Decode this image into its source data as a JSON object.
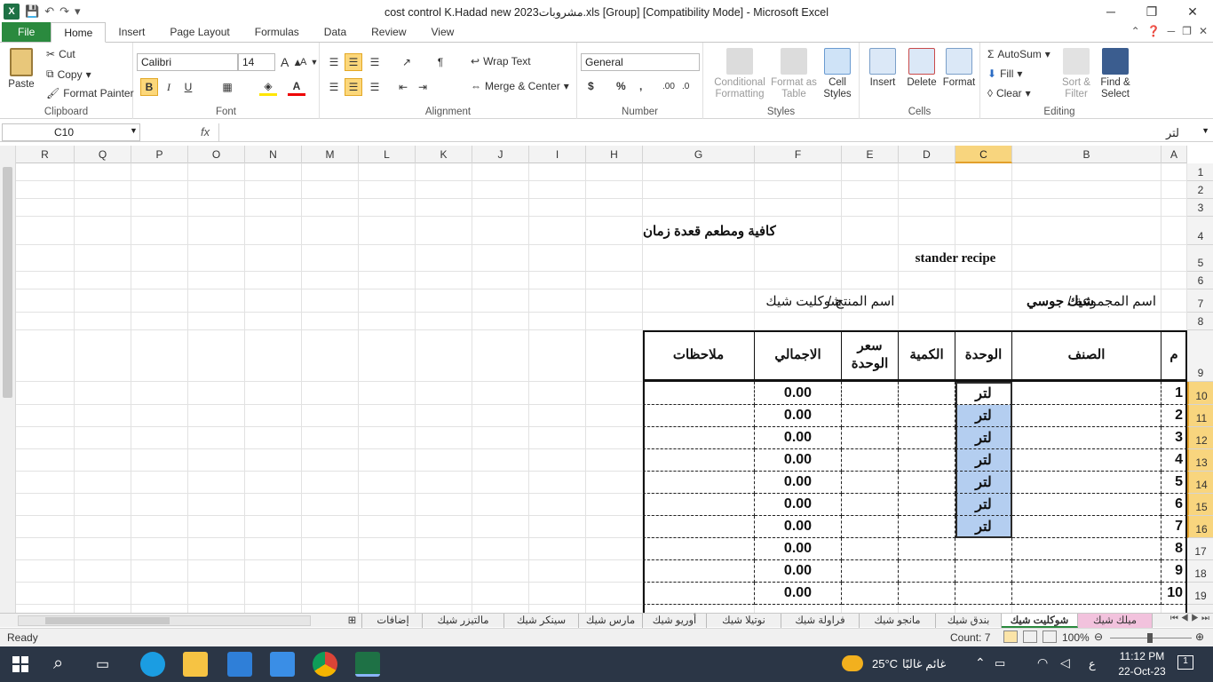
{
  "window": {
    "title": "cost control K.Hadad new 2023مشروبات.xls  [Group]  [Compatibility Mode]  -  Microsoft Excel",
    "controls": [
      "─",
      "❐",
      "✕"
    ]
  },
  "tabs": [
    "File",
    "Home",
    "Insert",
    "Page Layout",
    "Formulas",
    "Data",
    "Review",
    "View"
  ],
  "ribbon": {
    "clipboard": {
      "paste": "Paste",
      "cut": "Cut",
      "copy": "Copy",
      "format_painter": "Format Painter",
      "label": "Clipboard"
    },
    "font": {
      "name": "Calibri",
      "size": "14",
      "bold": "B",
      "italic": "I",
      "underline": "U",
      "label": "Font"
    },
    "alignment": {
      "wrap": "Wrap Text",
      "merge": "Merge & Center",
      "label": "Alignment"
    },
    "number": {
      "format": "General",
      "currency": "$",
      "percent": "%",
      "comma": ",",
      "label": "Number"
    },
    "styles": {
      "conditional": "Conditional Formatting",
      "table": "Format as Table",
      "cell": "Cell Styles",
      "label": "Styles"
    },
    "cells": {
      "insert": "Insert",
      "delete": "Delete",
      "format": "Format",
      "label": "Cells"
    },
    "editing": {
      "autosum": "AutoSum",
      "fill": "Fill",
      "clear": "Clear",
      "sort": "Sort & Filter",
      "find": "Find & Select",
      "label": "Editing"
    }
  },
  "formula_bar": {
    "name_box": "C10",
    "fx": "fx",
    "content": "لتر"
  },
  "columns": [
    "R",
    "Q",
    "P",
    "O",
    "N",
    "M",
    "L",
    "K",
    "J",
    "I",
    "H",
    "G",
    "F",
    "E",
    "D",
    "C",
    "B",
    "A"
  ],
  "rows": [
    "1",
    "2",
    "3",
    "4",
    "5",
    "6",
    "7",
    "8",
    "9",
    "10",
    "11",
    "12",
    "13",
    "14",
    "15",
    "16",
    "17",
    "18",
    "19"
  ],
  "sheet": {
    "company": "كافية ومطعم قعدة زمان",
    "recipe": "stander recipe",
    "group_label": "اسم المجموعة /",
    "group_value": "شيك جوسي",
    "product_label": "اسم المنتج /",
    "product_value": "شوكليت شيك",
    "headers": {
      "num": "م",
      "item": "الصنف",
      "unit": "الوحدة",
      "qty": "الكمية",
      "price": "سعر الوحدة",
      "total": "الاجمالي",
      "notes": "ملاحظات"
    },
    "rows": [
      {
        "num": "1",
        "unit": "لتر",
        "total": "0.00"
      },
      {
        "num": "2",
        "unit": "لتر",
        "total": "0.00"
      },
      {
        "num": "3",
        "unit": "لتر",
        "total": "0.00"
      },
      {
        "num": "4",
        "unit": "لتر",
        "total": "0.00"
      },
      {
        "num": "5",
        "unit": "لتر",
        "total": "0.00"
      },
      {
        "num": "6",
        "unit": "لتر",
        "total": "0.00"
      },
      {
        "num": "7",
        "unit": "لتر",
        "total": "0.00"
      },
      {
        "num": "8",
        "unit": "",
        "total": "0.00"
      },
      {
        "num": "9",
        "unit": "",
        "total": "0.00"
      },
      {
        "num": "10",
        "unit": "",
        "total": "0.00"
      }
    ]
  },
  "sheet_tabs": [
    "ميلك شيك",
    "شوكليت شيك",
    "بندق شيك",
    "مانجو شيك",
    "فراولة شيك",
    "نوتيلا شيك",
    "أوريو شيك",
    "مارس شيك",
    "سينكر شيك",
    "مالتيزر شيك",
    "إضافات"
  ],
  "status": {
    "ready": "Ready",
    "count": "Count: 7",
    "zoom": "100%"
  },
  "taskbar": {
    "weather_temp": "25°C",
    "weather_text": "غائم غالبًا",
    "lang": "ع",
    "time": "11:12 PM",
    "date": "22-Oct-23",
    "notif": "1"
  },
  "colors": {
    "excel_green": "#2a8a3e",
    "selection": "#b4cef0",
    "highlight_header": "#f8d57e",
    "group_tab": "#f2c2dd"
  }
}
